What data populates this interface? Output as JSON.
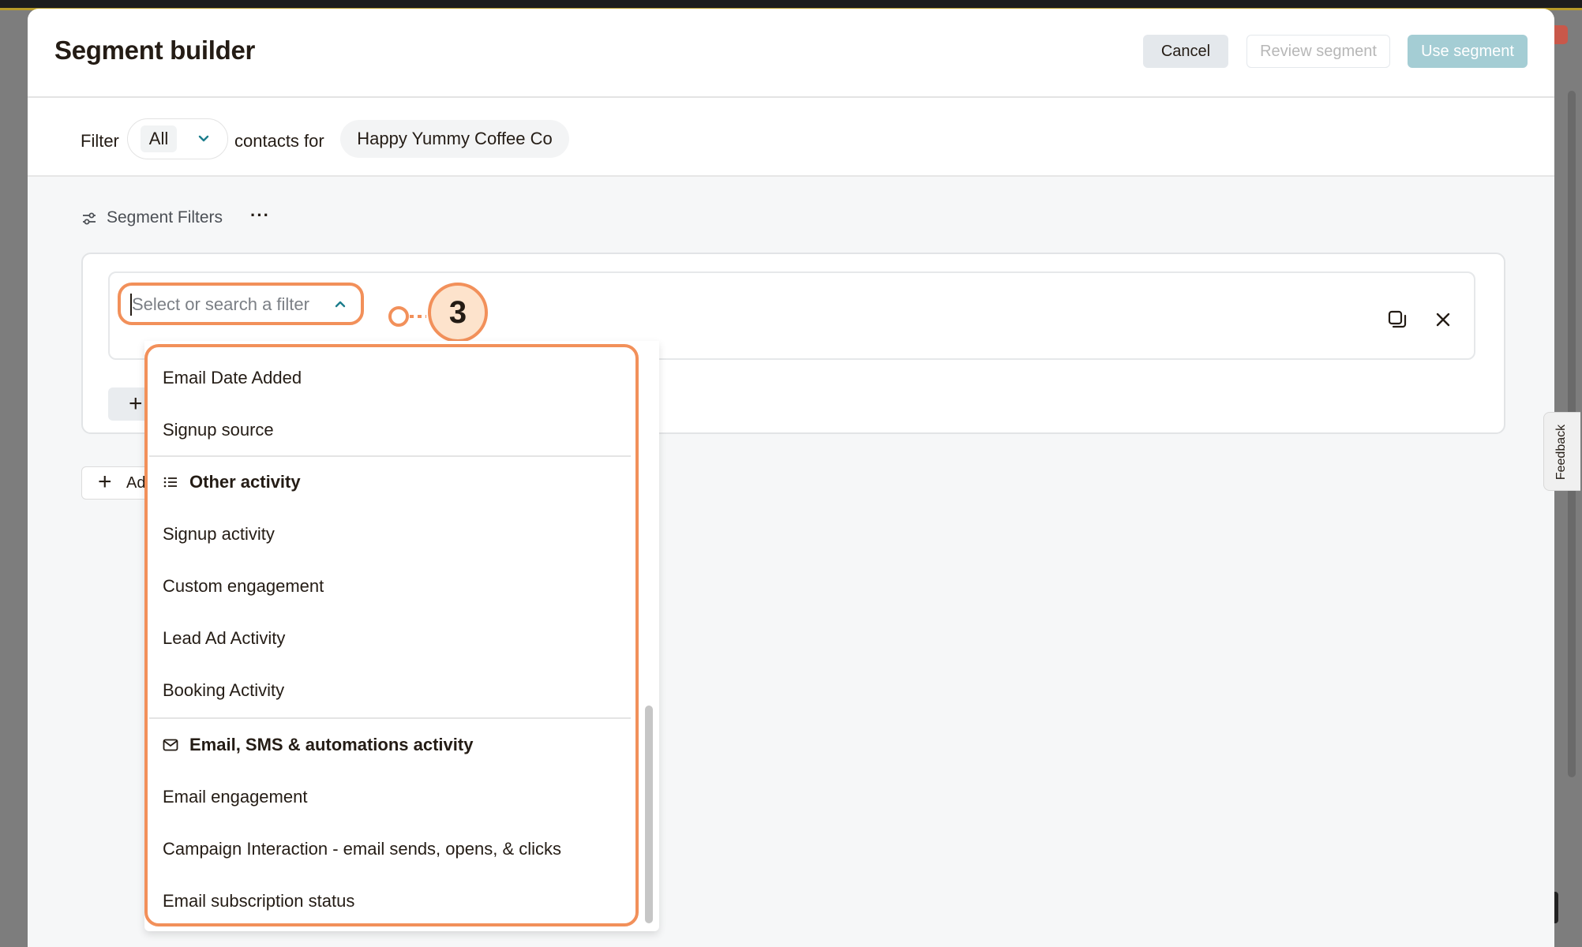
{
  "modal": {
    "title": "Segment builder",
    "cancel_label": "Cancel",
    "review_label": "Review segment",
    "use_label": "Use segment"
  },
  "filter_bar": {
    "filter_label": "Filter",
    "match_value": "All",
    "contacts_for_label": "contacts for",
    "audience_name": "Happy Yummy Coffee Co"
  },
  "segment_filters": {
    "label": "Segment Filters",
    "more_label": "···",
    "add_label": "Ad"
  },
  "filter_select": {
    "placeholder": "Select or search a filter"
  },
  "callout": {
    "number": "3"
  },
  "dropdown": {
    "items_top": [
      "Email Date Added",
      "Signup source"
    ],
    "group_other": {
      "header": "Other activity",
      "icon": "list-icon",
      "items": [
        "Signup activity",
        "Custom engagement",
        "Lead Ad Activity",
        "Booking Activity"
      ]
    },
    "group_email": {
      "header": "Email, SMS & automations activity",
      "icon": "envelope-icon",
      "items": [
        "Email engagement",
        "Campaign Interaction - email sends, opens, & clicks",
        "Email subscription status"
      ]
    }
  },
  "feedback": {
    "label": "Feedback"
  },
  "colors": {
    "accent": "#f2905a",
    "callout_fill": "#fde3cc",
    "primary_disabled": "#a4cdd4",
    "chevron": "#1c7d8c"
  }
}
